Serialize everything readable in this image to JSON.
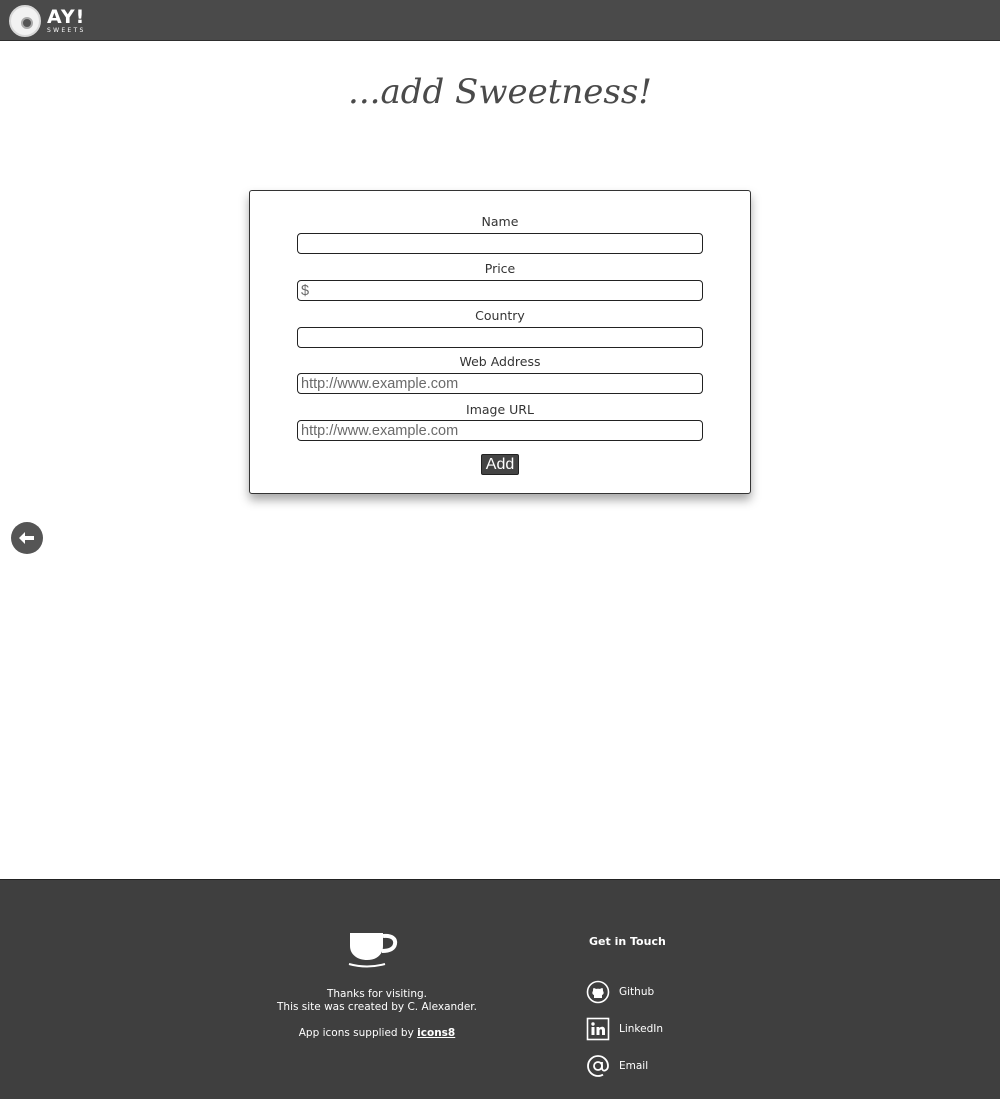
{
  "header": {
    "logo_main": "AY!",
    "logo_sub": "SWEETS"
  },
  "page": {
    "heading": "...add Sweetness!"
  },
  "form": {
    "fields": [
      {
        "label": "Name",
        "value": "",
        "placeholder": ""
      },
      {
        "label": "Price",
        "value": "",
        "placeholder": "$"
      },
      {
        "label": "Country",
        "value": "",
        "placeholder": ""
      },
      {
        "label": "Web Address",
        "value": "",
        "placeholder": "http://www.example.com"
      },
      {
        "label": "Image URL",
        "value": "",
        "placeholder": "http://www.example.com"
      }
    ],
    "submit_label": "Add"
  },
  "nav": {
    "back_icon": "arrow-left-icon"
  },
  "footer": {
    "cup_icon": "coffee-cup-icon",
    "thanks_line1": "Thanks for visiting.",
    "thanks_line2": "This site was created by C. Alexander.",
    "credits_prefix": "App icons supplied by ",
    "credits_link": "icons8",
    "contact_heading": "Get in Touch",
    "contacts": [
      {
        "label": "Github",
        "icon": "github-icon"
      },
      {
        "label": "LinkedIn",
        "icon": "linkedin-icon"
      },
      {
        "label": "Email",
        "icon": "at-sign-icon"
      }
    ]
  },
  "colors": {
    "header_bg": "#4a4a4a",
    "footer_bg": "#3f3f3f",
    "button_bg": "#444444"
  }
}
